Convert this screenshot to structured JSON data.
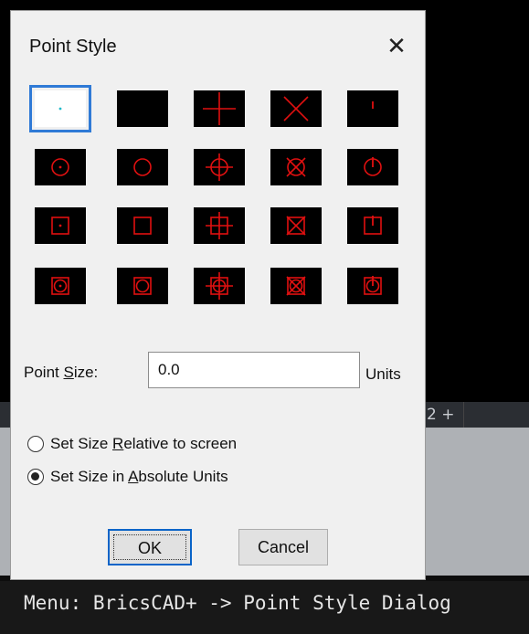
{
  "background": {
    "tab_add_label": "2 +",
    "command_line": "Menu: BricsCAD+ -> Point Style Dialog"
  },
  "dialog": {
    "title": "Point Style",
    "close_label": "✕",
    "point_styles": [
      "dot",
      "none",
      "plus",
      "x",
      "tick",
      "circle-dot",
      "circle",
      "circle-plus",
      "circle-x",
      "circle-tick",
      "square-dot",
      "square",
      "square-plus",
      "square-x",
      "square-tick",
      "square-circle-dot",
      "square-circle",
      "square-circle-plus",
      "square-circle-x",
      "square-circle-tick"
    ],
    "selected_style": "dot",
    "point_size_label": "Point Size:",
    "point_size_value": "0.0",
    "units_label": "Units",
    "radio_relative": "Set Size Relative to screen",
    "radio_absolute": "Set Size in Absolute Units",
    "selected_mode": "absolute",
    "ok_label": "OK",
    "cancel_label": "Cancel"
  },
  "colors": {
    "symbol": "#e01010",
    "cell_bg": "#000000",
    "selection": "#2f7ad6"
  }
}
